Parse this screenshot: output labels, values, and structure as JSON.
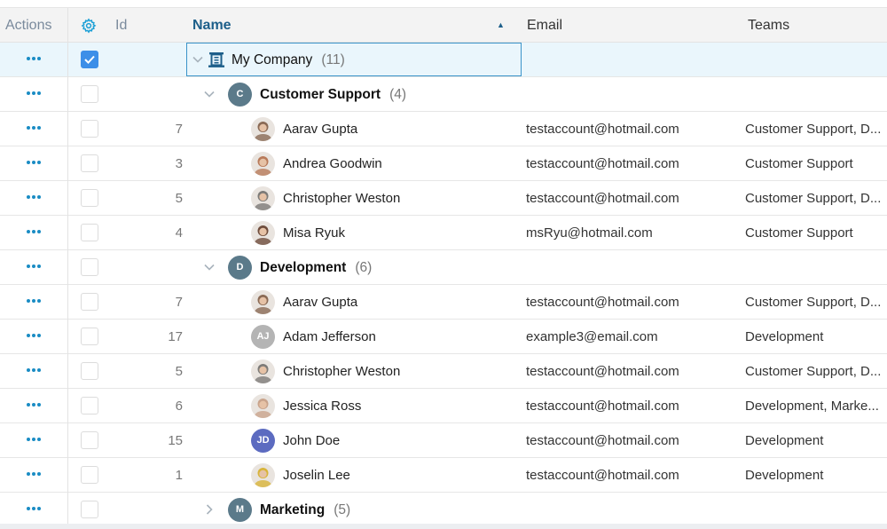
{
  "header": {
    "actions": "Actions",
    "settings_icon": "gear-icon",
    "id": "Id",
    "name": "Name",
    "sort_indicator": "▲",
    "email": "Email",
    "teams": "Teams"
  },
  "colors": {
    "accent": "#1a8cc4",
    "checkbox_checked": "#3d8fe8",
    "selected_row": "#eaf6fc",
    "group_avatar": "#5b7a8a"
  },
  "root": {
    "name": "My Company",
    "count": "(11)",
    "icon": "building-icon",
    "checked": true,
    "expanded": true
  },
  "groups": [
    {
      "initial": "C",
      "name": "Customer Support",
      "count": "(4)",
      "expanded": true,
      "members": [
        {
          "id": "7",
          "name": "Aarav Gupta",
          "email": "testaccount@hotmail.com",
          "teams": "Customer Support, D...",
          "avatar": "photo",
          "avatar_color": "#8a6a55"
        },
        {
          "id": "3",
          "name": "Andrea Goodwin",
          "email": "testaccount@hotmail.com",
          "teams": "Customer Support",
          "avatar": "photo",
          "avatar_color": "#b87a5a"
        },
        {
          "id": "5",
          "name": "Christopher Weston",
          "email": "testaccount@hotmail.com",
          "teams": "Customer Support, D...",
          "avatar": "photo",
          "avatar_color": "#7d7b78"
        },
        {
          "id": "4",
          "name": "Misa Ryuk",
          "email": "msRyu@hotmail.com",
          "teams": "Customer Support",
          "avatar": "photo",
          "avatar_color": "#6e4c3c"
        }
      ]
    },
    {
      "initial": "D",
      "name": "Development",
      "count": "(6)",
      "expanded": true,
      "members": [
        {
          "id": "7",
          "name": "Aarav Gupta",
          "email": "testaccount@hotmail.com",
          "teams": "Customer Support, D...",
          "avatar": "photo",
          "avatar_color": "#8a6a55"
        },
        {
          "id": "17",
          "name": "Adam Jefferson",
          "email": "example3@email.com",
          "teams": "Development",
          "avatar": "AJ",
          "avatar_color": "#b4b4b4"
        },
        {
          "id": "5",
          "name": "Christopher Weston",
          "email": "testaccount@hotmail.com",
          "teams": "Customer Support, D...",
          "avatar": "photo",
          "avatar_color": "#7d7b78"
        },
        {
          "id": "6",
          "name": "Jessica Ross",
          "email": "testaccount@hotmail.com",
          "teams": "Development, Marke...",
          "avatar": "photo",
          "avatar_color": "#c9a48c"
        },
        {
          "id": "15",
          "name": "John Doe",
          "email": "testaccount@hotmail.com",
          "teams": "Development",
          "avatar": "JD",
          "avatar_color": "#5c6bc0"
        },
        {
          "id": "1",
          "name": "Joselin Lee",
          "email": "testaccount@hotmail.com",
          "teams": "Development",
          "avatar": "photo",
          "avatar_color": "#d8b43a"
        }
      ]
    },
    {
      "initial": "M",
      "name": "Marketing",
      "count": "(5)",
      "expanded": false,
      "members": []
    }
  ]
}
